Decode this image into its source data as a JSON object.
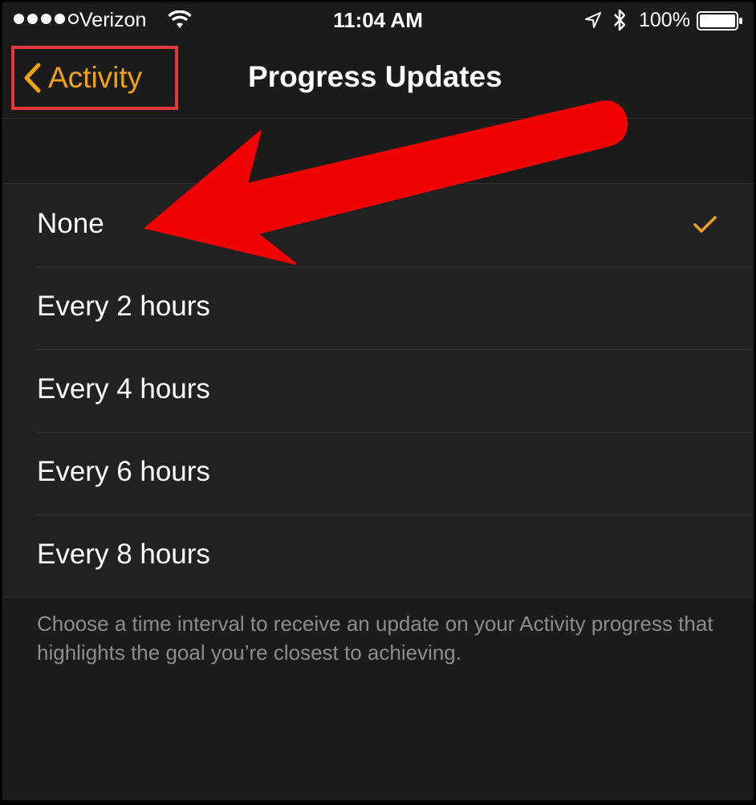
{
  "status_bar": {
    "carrier": "Verizon",
    "time": "11:04 AM",
    "battery": "100%"
  },
  "nav": {
    "back_label": "Activity",
    "title": "Progress Updates"
  },
  "options": [
    {
      "label": "None",
      "selected": true
    },
    {
      "label": "Every 2 hours",
      "selected": false
    },
    {
      "label": "Every 4 hours",
      "selected": false
    },
    {
      "label": "Every 6 hours",
      "selected": false
    },
    {
      "label": "Every 8 hours",
      "selected": false
    }
  ],
  "footer_note": "Choose a time interval to receive an update on your Activity progress that highlights the goal you’re closest to achieving.",
  "colors": {
    "accent": "#f3a20f",
    "annotation": "#f00000",
    "highlight_box": "#e2393d",
    "background": "#1b1b1b"
  }
}
